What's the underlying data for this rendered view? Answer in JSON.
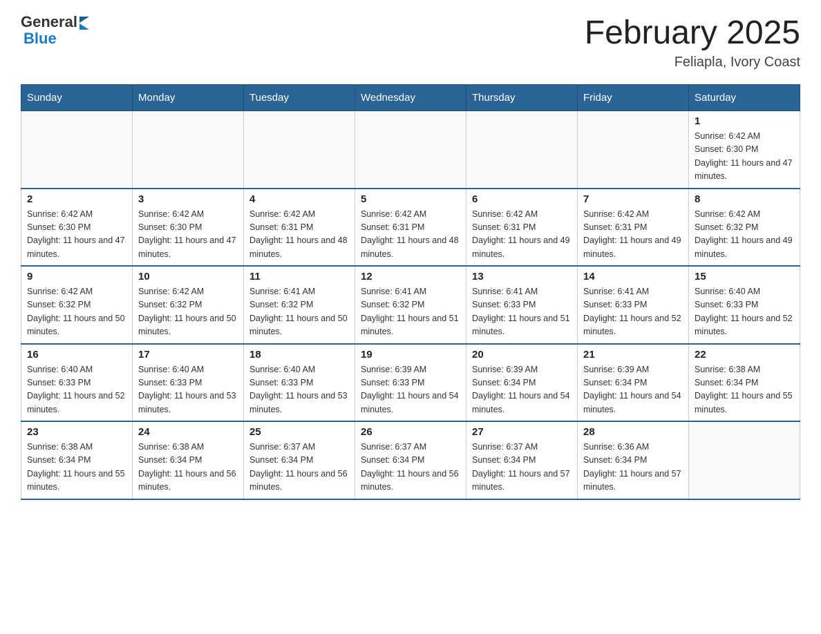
{
  "header": {
    "logo": {
      "general": "General",
      "blue": "Blue"
    },
    "title": "February 2025",
    "location": "Feliapla, Ivory Coast"
  },
  "weekdays": [
    "Sunday",
    "Monday",
    "Tuesday",
    "Wednesday",
    "Thursday",
    "Friday",
    "Saturday"
  ],
  "weeks": [
    [
      {
        "day": "",
        "info": ""
      },
      {
        "day": "",
        "info": ""
      },
      {
        "day": "",
        "info": ""
      },
      {
        "day": "",
        "info": ""
      },
      {
        "day": "",
        "info": ""
      },
      {
        "day": "",
        "info": ""
      },
      {
        "day": "1",
        "info": "Sunrise: 6:42 AM\nSunset: 6:30 PM\nDaylight: 11 hours and 47 minutes."
      }
    ],
    [
      {
        "day": "2",
        "info": "Sunrise: 6:42 AM\nSunset: 6:30 PM\nDaylight: 11 hours and 47 minutes."
      },
      {
        "day": "3",
        "info": "Sunrise: 6:42 AM\nSunset: 6:30 PM\nDaylight: 11 hours and 47 minutes."
      },
      {
        "day": "4",
        "info": "Sunrise: 6:42 AM\nSunset: 6:31 PM\nDaylight: 11 hours and 48 minutes."
      },
      {
        "day": "5",
        "info": "Sunrise: 6:42 AM\nSunset: 6:31 PM\nDaylight: 11 hours and 48 minutes."
      },
      {
        "day": "6",
        "info": "Sunrise: 6:42 AM\nSunset: 6:31 PM\nDaylight: 11 hours and 49 minutes."
      },
      {
        "day": "7",
        "info": "Sunrise: 6:42 AM\nSunset: 6:31 PM\nDaylight: 11 hours and 49 minutes."
      },
      {
        "day": "8",
        "info": "Sunrise: 6:42 AM\nSunset: 6:32 PM\nDaylight: 11 hours and 49 minutes."
      }
    ],
    [
      {
        "day": "9",
        "info": "Sunrise: 6:42 AM\nSunset: 6:32 PM\nDaylight: 11 hours and 50 minutes."
      },
      {
        "day": "10",
        "info": "Sunrise: 6:42 AM\nSunset: 6:32 PM\nDaylight: 11 hours and 50 minutes."
      },
      {
        "day": "11",
        "info": "Sunrise: 6:41 AM\nSunset: 6:32 PM\nDaylight: 11 hours and 50 minutes."
      },
      {
        "day": "12",
        "info": "Sunrise: 6:41 AM\nSunset: 6:32 PM\nDaylight: 11 hours and 51 minutes."
      },
      {
        "day": "13",
        "info": "Sunrise: 6:41 AM\nSunset: 6:33 PM\nDaylight: 11 hours and 51 minutes."
      },
      {
        "day": "14",
        "info": "Sunrise: 6:41 AM\nSunset: 6:33 PM\nDaylight: 11 hours and 52 minutes."
      },
      {
        "day": "15",
        "info": "Sunrise: 6:40 AM\nSunset: 6:33 PM\nDaylight: 11 hours and 52 minutes."
      }
    ],
    [
      {
        "day": "16",
        "info": "Sunrise: 6:40 AM\nSunset: 6:33 PM\nDaylight: 11 hours and 52 minutes."
      },
      {
        "day": "17",
        "info": "Sunrise: 6:40 AM\nSunset: 6:33 PM\nDaylight: 11 hours and 53 minutes."
      },
      {
        "day": "18",
        "info": "Sunrise: 6:40 AM\nSunset: 6:33 PM\nDaylight: 11 hours and 53 minutes."
      },
      {
        "day": "19",
        "info": "Sunrise: 6:39 AM\nSunset: 6:33 PM\nDaylight: 11 hours and 54 minutes."
      },
      {
        "day": "20",
        "info": "Sunrise: 6:39 AM\nSunset: 6:34 PM\nDaylight: 11 hours and 54 minutes."
      },
      {
        "day": "21",
        "info": "Sunrise: 6:39 AM\nSunset: 6:34 PM\nDaylight: 11 hours and 54 minutes."
      },
      {
        "day": "22",
        "info": "Sunrise: 6:38 AM\nSunset: 6:34 PM\nDaylight: 11 hours and 55 minutes."
      }
    ],
    [
      {
        "day": "23",
        "info": "Sunrise: 6:38 AM\nSunset: 6:34 PM\nDaylight: 11 hours and 55 minutes."
      },
      {
        "day": "24",
        "info": "Sunrise: 6:38 AM\nSunset: 6:34 PM\nDaylight: 11 hours and 56 minutes."
      },
      {
        "day": "25",
        "info": "Sunrise: 6:37 AM\nSunset: 6:34 PM\nDaylight: 11 hours and 56 minutes."
      },
      {
        "day": "26",
        "info": "Sunrise: 6:37 AM\nSunset: 6:34 PM\nDaylight: 11 hours and 56 minutes."
      },
      {
        "day": "27",
        "info": "Sunrise: 6:37 AM\nSunset: 6:34 PM\nDaylight: 11 hours and 57 minutes."
      },
      {
        "day": "28",
        "info": "Sunrise: 6:36 AM\nSunset: 6:34 PM\nDaylight: 11 hours and 57 minutes."
      },
      {
        "day": "",
        "info": ""
      }
    ]
  ]
}
